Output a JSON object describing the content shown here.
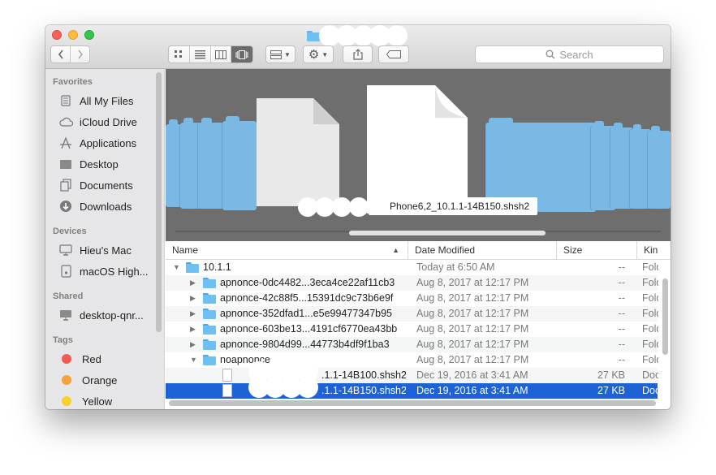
{
  "window": {
    "title": ""
  },
  "toolbar": {
    "back_icon": "chevron-left-icon",
    "forward_icon": "chevron-right-icon",
    "view_icons": [
      "icon-view-icon",
      "list-view-icon",
      "column-view-icon",
      "cover-flow-view-icon"
    ],
    "active_view": "cover-flow",
    "search_placeholder": "Search"
  },
  "sidebar": {
    "favorites_heading": "Favorites",
    "favorites": [
      {
        "label": "All My Files",
        "icon": "all-files-icon"
      },
      {
        "label": "iCloud Drive",
        "icon": "cloud-icon"
      },
      {
        "label": "Applications",
        "icon": "applications-icon"
      },
      {
        "label": "Desktop",
        "icon": "desktop-icon"
      },
      {
        "label": "Documents",
        "icon": "documents-icon"
      },
      {
        "label": "Downloads",
        "icon": "downloads-icon"
      }
    ],
    "devices_heading": "Devices",
    "devices": [
      {
        "label": "Hieu's Mac",
        "icon": "computer-icon"
      },
      {
        "label": "macOS High...",
        "icon": "disk-icon"
      }
    ],
    "shared_heading": "Shared",
    "shared": [
      {
        "label": "desktop-qnr...",
        "icon": "network-computer-icon"
      }
    ],
    "tags_heading": "Tags",
    "tags": [
      {
        "label": "Red",
        "color": "#f35a53"
      },
      {
        "label": "Orange",
        "color": "#f6a23a"
      },
      {
        "label": "Yellow",
        "color": "#f6d22f"
      }
    ]
  },
  "coverflow": {
    "selected_label": "Phone6,2_10.1.1-14B150.shsh2"
  },
  "list": {
    "columns": {
      "name": "Name",
      "date": "Date Modified",
      "size": "Size",
      "kind": "Kin"
    },
    "rows": [
      {
        "name": "10.1.1",
        "date": "Today at 6:50 AM",
        "size": "--",
        "kind": "Fold"
      },
      {
        "name": "apnonce-0dc4482...3eca4ce22af11cb3",
        "date": "Aug 8, 2017 at 12:17 PM",
        "size": "--",
        "kind": "Fold"
      },
      {
        "name": "apnonce-42c88f5...15391dc9c73b6e9f",
        "date": "Aug 8, 2017 at 12:17 PM",
        "size": "--",
        "kind": "Fold"
      },
      {
        "name": "apnonce-352dfad1...e5e99477347b95",
        "date": "Aug 8, 2017 at 12:17 PM",
        "size": "--",
        "kind": "Fold"
      },
      {
        "name": "apnonce-603be13...4191cf6770ea43bb",
        "date": "Aug 8, 2017 at 12:17 PM",
        "size": "--",
        "kind": "Fold"
      },
      {
        "name": "apnonce-9804d99...44773b4df9f1ba3",
        "date": "Aug 8, 2017 at 12:17 PM",
        "size": "--",
        "kind": "Fold"
      },
      {
        "name": "noapnonce",
        "date": "Aug 8, 2017 at 12:17 PM",
        "size": "--",
        "kind": "Fold"
      },
      {
        "name": ".1.1-14B100.shsh2",
        "date": "Dec 19, 2016 at 3:41 AM",
        "size": "27 KB",
        "kind": "Doc"
      },
      {
        "name": ".1.1-14B150.shsh2",
        "date": "Dec 19, 2016 at 3:41 AM",
        "size": "27 KB",
        "kind": "Doc"
      }
    ]
  }
}
